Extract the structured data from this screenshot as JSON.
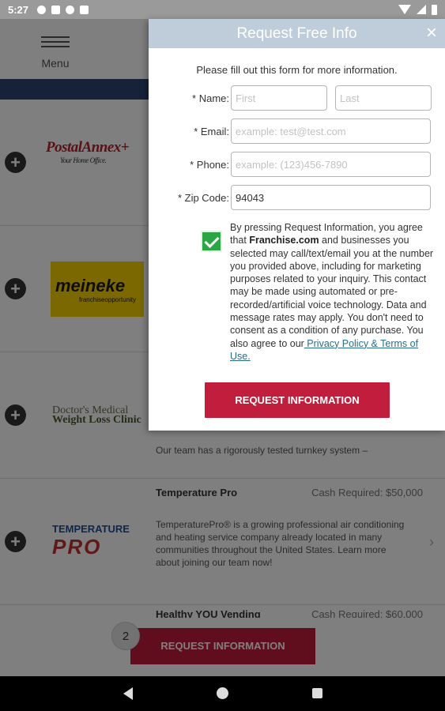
{
  "status_bar": {
    "time": "5:27"
  },
  "header": {
    "menu_label": "Menu"
  },
  "listings": [
    {
      "logo": "PostalAnnex+",
      "logo_sub": "Your Home Office.",
      "title": "",
      "cash": "",
      "description": ""
    },
    {
      "logo": "meineke",
      "logo_sub": "franchiseopportunity",
      "title": "",
      "cash": "",
      "description": ""
    },
    {
      "logo": "Doctor's Medical",
      "logo_sub": "Weight Loss Clinic",
      "title": "",
      "cash": "",
      "description": "Our team has a rigorously tested turnkey system –"
    },
    {
      "logo": "TEMPERATURE",
      "logo_sub": "PRO",
      "title": "Temperature Pro",
      "cash": "Cash Required: $50,000",
      "description": "TemperaturePro® is a growing professional air conditioning and heating service company already located in many communities throughout the United States. Learn more about joining our team now!"
    }
  ],
  "peek_listing": {
    "title": "Healthy YOU Vending",
    "cash": "Cash Required: $60,000"
  },
  "bottom_bar": {
    "count": "2",
    "button_label": "REQUEST INFORMATION"
  },
  "modal": {
    "title": "Request Free Info",
    "close": "×",
    "intro": "Please fill out this form for more information.",
    "fields": {
      "name_label": "* Name:",
      "first_placeholder": "First",
      "last_placeholder": "Last",
      "email_label": "* Email:",
      "email_placeholder": "example: test@test.com",
      "phone_label": "* Phone:",
      "phone_placeholder": "example: (123)456-7890",
      "zip_label": "* Zip Code:",
      "zip_value": "94043"
    },
    "consent": {
      "checked": true,
      "text_1": "By pressing Request Information, you agree that ",
      "brand": "Franchise.com",
      "text_2": " and businesses you selected may call/text/email you at the number you provided above, including for marketing purposes related to your inquiry. This contact may be made using automated or pre-recorded/artificial voice technology. Data and message rates may apply. You don't need to consent as a condition of any purchase. You also agree to our",
      "link": " Privacy Policy & Terms of Use."
    },
    "submit_label": "REQUEST INFORMATION"
  },
  "colors": {
    "accent": "#c11d3d",
    "header": "#bfcdda",
    "check": "#2aa745",
    "link": "#2a6d8a"
  }
}
